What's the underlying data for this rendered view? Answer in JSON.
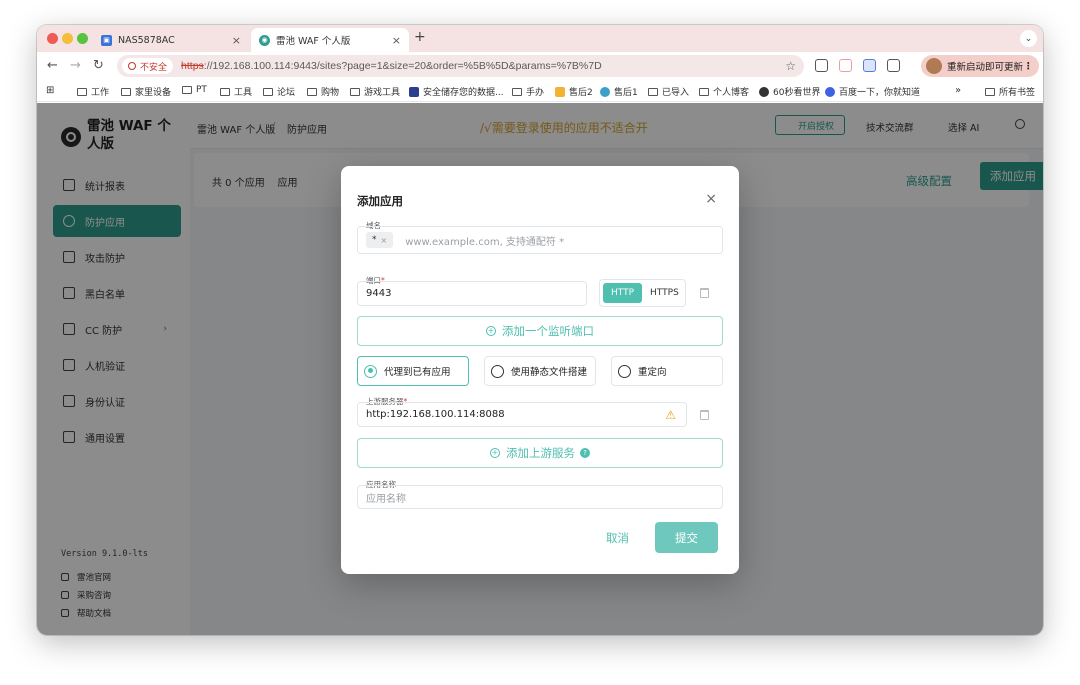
{
  "browser": {
    "tabs": [
      {
        "title": "NAS5878AC",
        "favicon": "nas-icon"
      },
      {
        "title": "雷池 WAF 个人版",
        "favicon": "safeline-icon"
      }
    ],
    "insecure_label": "不安全",
    "url_scheme": "https",
    "url_rest": "://192.168.100.114:9443/sites?page=1&size=20&order=%5B%5D&params=%7B%7D",
    "update_label": "重新启动即可更新",
    "bookmarks": [
      "工作",
      "家里设备",
      "PT",
      "工具",
      "论坛",
      "购物",
      "游戏工具",
      "安全储存您的数据...",
      "手办",
      "售后2",
      "售后1",
      "已导入",
      "个人博客",
      "60秒看世界",
      "百度一下，你就知道"
    ],
    "all_bookmarks": "所有书签"
  },
  "app": {
    "brand": "雷池 WAF 个人版",
    "menu": [
      "统计报表",
      "防护应用",
      "攻击防护",
      "黑白名单",
      "CC 防护",
      "人机验证",
      "身份认证",
      "通用设置"
    ],
    "version": "Version 9.1.0-lts",
    "footer_links": [
      "雷池官网",
      "采购咨询",
      "帮助文档"
    ],
    "breadcrumb": [
      "雷池 WAF 个人版",
      "防护应用"
    ],
    "notice": "/√需要登录使用的应用不适合开",
    "free_auth_label": "开启授权",
    "header_links": [
      "技术交流群",
      "选择 AI"
    ],
    "count_label": "共 0 个应用",
    "count_suffix": "应用",
    "advanced_label": "高级配置",
    "add_app_label": "添加应用"
  },
  "modal": {
    "title": "添加应用",
    "domain_label": "域名",
    "domain_chip": "*",
    "domain_placeholder": "www.example.com, 支持通配符 *",
    "port_label": "端口",
    "port_value": "9443",
    "protocols": [
      "HTTP",
      "HTTPS"
    ],
    "protocol_selected": "HTTP",
    "add_port_label": "添加一个监听端口",
    "modes": [
      "代理到已有应用",
      "使用静态文件搭建",
      "重定向"
    ],
    "mode_selected": "代理到已有应用",
    "upstream_label": "上游服务器",
    "upstream_value": "http:192.168.100.114:8088",
    "add_upstream_label": "添加上游服务",
    "app_name_label": "应用名称",
    "app_name_placeholder": "应用名称",
    "cancel_label": "取消",
    "submit_label": "提交"
  },
  "colors": {
    "accent": "#4fbfb0",
    "accent_dark": "#2f9e8f",
    "warning": "#f0a020",
    "tabstrip": "#f5e3e3"
  }
}
